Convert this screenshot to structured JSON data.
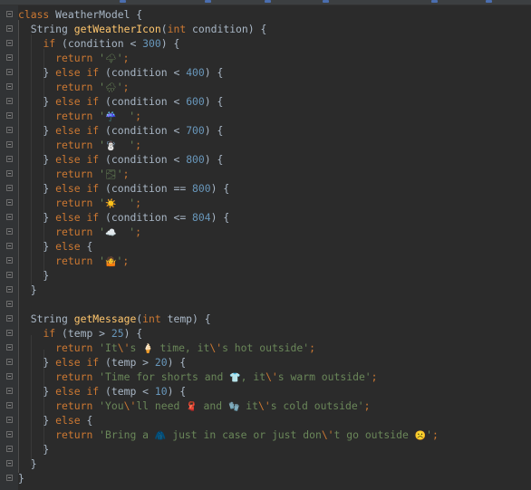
{
  "editor": {
    "lines": [
      [
        [
          "kw",
          "class "
        ],
        [
          "pl",
          "WeatherModel {"
        ]
      ],
      [
        [
          "pl",
          "  String "
        ],
        [
          "fn",
          "getWeatherIcon"
        ],
        [
          "pl",
          "("
        ],
        [
          "kw",
          "int "
        ],
        [
          "pl",
          "condition) {"
        ]
      ],
      [
        [
          "pl",
          "    "
        ],
        [
          "kw",
          "if "
        ],
        [
          "pl",
          "(condition < "
        ],
        [
          "num",
          "300"
        ],
        [
          "pl",
          ") {"
        ]
      ],
      [
        [
          "pl",
          "      "
        ],
        [
          "kw",
          "return "
        ],
        [
          "str",
          "'"
        ],
        [
          "emoji",
          "🌩"
        ],
        [
          "str",
          "'"
        ],
        [
          "kw",
          ";"
        ]
      ],
      [
        [
          "pl",
          "    } "
        ],
        [
          "kw",
          "else if "
        ],
        [
          "pl",
          "(condition < "
        ],
        [
          "num",
          "400"
        ],
        [
          "pl",
          ") {"
        ]
      ],
      [
        [
          "pl",
          "      "
        ],
        [
          "kw",
          "return "
        ],
        [
          "str",
          "'"
        ],
        [
          "emoji",
          "🌧"
        ],
        [
          "str",
          "'"
        ],
        [
          "kw",
          ";"
        ]
      ],
      [
        [
          "pl",
          "    } "
        ],
        [
          "kw",
          "else if "
        ],
        [
          "pl",
          "(condition < "
        ],
        [
          "num",
          "600"
        ],
        [
          "pl",
          ") {"
        ]
      ],
      [
        [
          "pl",
          "      "
        ],
        [
          "kw",
          "return "
        ],
        [
          "str",
          "'"
        ],
        [
          "emoji",
          "☔️"
        ],
        [
          "str",
          "  '"
        ],
        [
          "kw",
          ";"
        ]
      ],
      [
        [
          "pl",
          "    } "
        ],
        [
          "kw",
          "else if "
        ],
        [
          "pl",
          "(condition < "
        ],
        [
          "num",
          "700"
        ],
        [
          "pl",
          ") {"
        ]
      ],
      [
        [
          "pl",
          "      "
        ],
        [
          "kw",
          "return "
        ],
        [
          "str",
          "'"
        ],
        [
          "emoji",
          "☃️"
        ],
        [
          "str",
          "  '"
        ],
        [
          "kw",
          ";"
        ]
      ],
      [
        [
          "pl",
          "    } "
        ],
        [
          "kw",
          "else if "
        ],
        [
          "pl",
          "(condition < "
        ],
        [
          "num",
          "800"
        ],
        [
          "pl",
          ") {"
        ]
      ],
      [
        [
          "pl",
          "      "
        ],
        [
          "kw",
          "return "
        ],
        [
          "str",
          "'"
        ],
        [
          "emoji",
          "🌫"
        ],
        [
          "str",
          "'"
        ],
        [
          "kw",
          ";"
        ]
      ],
      [
        [
          "pl",
          "    } "
        ],
        [
          "kw",
          "else if "
        ],
        [
          "pl",
          "(condition == "
        ],
        [
          "num",
          "800"
        ],
        [
          "pl",
          ") {"
        ]
      ],
      [
        [
          "pl",
          "      "
        ],
        [
          "kw",
          "return "
        ],
        [
          "str",
          "'"
        ],
        [
          "emoji",
          "☀️"
        ],
        [
          "str",
          "  '"
        ],
        [
          "kw",
          ";"
        ]
      ],
      [
        [
          "pl",
          "    } "
        ],
        [
          "kw",
          "else if "
        ],
        [
          "pl",
          "(condition <= "
        ],
        [
          "num",
          "804"
        ],
        [
          "pl",
          ") {"
        ]
      ],
      [
        [
          "pl",
          "      "
        ],
        [
          "kw",
          "return "
        ],
        [
          "str",
          "'"
        ],
        [
          "emoji",
          "☁️"
        ],
        [
          "str",
          "  '"
        ],
        [
          "kw",
          ";"
        ]
      ],
      [
        [
          "pl",
          "    } "
        ],
        [
          "kw",
          "else "
        ],
        [
          "pl",
          "{"
        ]
      ],
      [
        [
          "pl",
          "      "
        ],
        [
          "kw",
          "return "
        ],
        [
          "str",
          "'"
        ],
        [
          "emoji",
          "🤷‍"
        ],
        [
          "str",
          "'"
        ],
        [
          "kw",
          ";"
        ]
      ],
      [
        [
          "pl",
          "    }"
        ]
      ],
      [
        [
          "pl",
          "  }"
        ]
      ],
      [],
      [
        [
          "pl",
          "  String "
        ],
        [
          "fn",
          "getMessage"
        ],
        [
          "pl",
          "("
        ],
        [
          "kw",
          "int "
        ],
        [
          "pl",
          "temp) {"
        ]
      ],
      [
        [
          "pl",
          "    "
        ],
        [
          "kw",
          "if "
        ],
        [
          "pl",
          "(temp > "
        ],
        [
          "num",
          "25"
        ],
        [
          "pl",
          ") {"
        ]
      ],
      [
        [
          "pl",
          "      "
        ],
        [
          "kw",
          "return "
        ],
        [
          "str",
          "'It"
        ],
        [
          "esc",
          "\\'"
        ],
        [
          "str",
          "s "
        ],
        [
          "emoji",
          "🍦"
        ],
        [
          "str",
          " time, it"
        ],
        [
          "esc",
          "\\'"
        ],
        [
          "str",
          "s hot outside'"
        ],
        [
          "kw",
          ";"
        ]
      ],
      [
        [
          "pl",
          "    } "
        ],
        [
          "kw",
          "else if "
        ],
        [
          "pl",
          "(temp > "
        ],
        [
          "num",
          "20"
        ],
        [
          "pl",
          ") {"
        ]
      ],
      [
        [
          "pl",
          "      "
        ],
        [
          "kw",
          "return "
        ],
        [
          "str",
          "'Time for shorts and "
        ],
        [
          "emoji",
          "👕"
        ],
        [
          "str",
          ", it"
        ],
        [
          "esc",
          "\\'"
        ],
        [
          "str",
          "s warm outside'"
        ],
        [
          "kw",
          ";"
        ]
      ],
      [
        [
          "pl",
          "    } "
        ],
        [
          "kw",
          "else if "
        ],
        [
          "pl",
          "(temp < "
        ],
        [
          "num",
          "10"
        ],
        [
          "pl",
          ") {"
        ]
      ],
      [
        [
          "pl",
          "      "
        ],
        [
          "kw",
          "return "
        ],
        [
          "str",
          "'You"
        ],
        [
          "esc",
          "\\'"
        ],
        [
          "str",
          "ll need "
        ],
        [
          "emoji",
          "🧣"
        ],
        [
          "str",
          " and "
        ],
        [
          "emoji",
          "🧤"
        ],
        [
          "str",
          " it"
        ],
        [
          "esc",
          "\\'"
        ],
        [
          "str",
          "s cold outside'"
        ],
        [
          "kw",
          ";"
        ]
      ],
      [
        [
          "pl",
          "    } "
        ],
        [
          "kw",
          "else "
        ],
        [
          "pl",
          "{"
        ]
      ],
      [
        [
          "pl",
          "      "
        ],
        [
          "kw",
          "return "
        ],
        [
          "str",
          "'Bring a "
        ],
        [
          "emoji",
          "🧥"
        ],
        [
          "str",
          " just in case or just don"
        ],
        [
          "esc",
          "\\'"
        ],
        [
          "str",
          "t go outside "
        ],
        [
          "emoji",
          "☹️"
        ],
        [
          "str",
          "'"
        ],
        [
          "kw",
          ";"
        ]
      ],
      [
        [
          "pl",
          "    }"
        ]
      ],
      [
        [
          "pl",
          "  }"
        ]
      ],
      [
        [
          "pl",
          "}"
        ]
      ]
    ]
  }
}
